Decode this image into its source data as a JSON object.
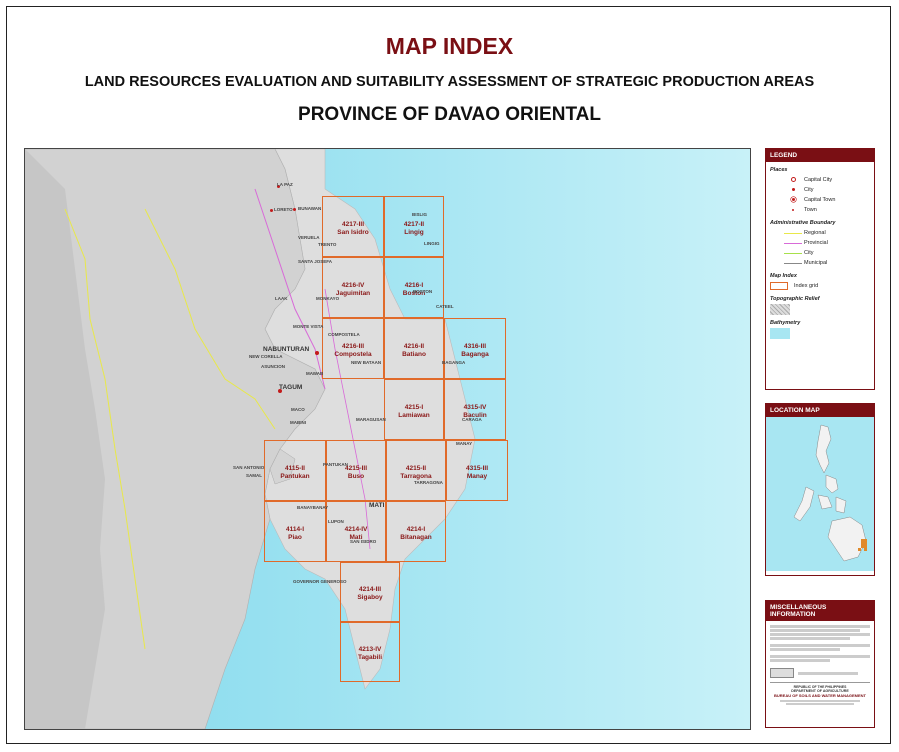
{
  "header": {
    "title": "MAP INDEX",
    "subtitle": "LAND RESOURCES EVALUATION AND SUITABILITY ASSESSMENT OF STRATEGIC PRODUCTION AREAS",
    "province": "PROVINCE OF DAVAO ORIENTAL"
  },
  "grid": [
    {
      "code": "4217-III",
      "name": "San Isidro"
    },
    {
      "code": "4217-II",
      "name": "Lingig"
    },
    {
      "code": "4216-IV",
      "name": "Jaguimitan"
    },
    {
      "code": "4216-I",
      "name": "Boston"
    },
    {
      "code": "4216-III",
      "name": "Compostela"
    },
    {
      "code": "4216-II",
      "name": "Batiano"
    },
    {
      "code": "4316-III",
      "name": "Baganga"
    },
    {
      "code": "4215-I",
      "name": "Lamiawan"
    },
    {
      "code": "4315-IV",
      "name": "Baculin"
    },
    {
      "code": "4115-II",
      "name": "Pantukan"
    },
    {
      "code": "4215-III",
      "name": "Buso"
    },
    {
      "code": "4215-II",
      "name": "Tarragona"
    },
    {
      "code": "4315-III",
      "name": "Manay"
    },
    {
      "code": "4114-I",
      "name": "Piao"
    },
    {
      "code": "4214-IV",
      "name": "Mati"
    },
    {
      "code": "4214-I",
      "name": "Bitanagan"
    },
    {
      "code": "4214-III",
      "name": "Sigaboy"
    },
    {
      "code": "4213-IV",
      "name": "Tagabili"
    }
  ],
  "places": {
    "la_paz": "LA PAZ",
    "bunawan": "BUNAWAN",
    "loreto": "LORETO",
    "bislig": "BISLIG",
    "veruela": "VERUELA",
    "trento": "TRENTO",
    "lingig": "LINGIG",
    "santa_josefa": "SANTA JOSEFA",
    "boston": "BOSTON",
    "laak": "LAAK",
    "monkayo": "MONKAYO",
    "cateel": "CATEEL",
    "monte_vista": "MONTE VISTA",
    "compostela": "COMPOSTELA",
    "nabunturan": "NABUNTURAN",
    "new_corella": "NEW CORELLA",
    "asuncion": "ASUNCION",
    "mawab": "MAWAB",
    "new_bataan": "NEW BATAAN",
    "baganga": "BAGANGA",
    "tagum": "TAGUM",
    "maco": "MACO",
    "mabini": "MABINI",
    "maragusan": "MARAGUSAN",
    "caraga": "CARAGA",
    "manay": "MANAY",
    "pantukan": "PANTUKAN",
    "san_antonio": "SAN ANTONIO",
    "samal": "SAMAL",
    "tarragona": "TARRAGONA",
    "banaybanay": "BANAYBANAY",
    "mati": "MATI",
    "lupon": "LUPON",
    "san_isidro": "SAN ISIDRO",
    "governor_generoso": "GOVERNOR GENEROSO"
  },
  "legend": {
    "title": "LEGEND",
    "places_heading": "Places",
    "places": [
      "Capital City",
      "City",
      "Capital Town",
      "Town"
    ],
    "admin_heading": "Administrative Boundary",
    "admin": [
      "Regional",
      "Provincial",
      "City",
      "Municipal"
    ],
    "admin_colors": [
      "#e8e84a",
      "#d86ad8",
      "#a8e04a",
      "#888888"
    ],
    "mapindex_heading": "Map Index",
    "index_grid": "Index grid",
    "relief_heading": "Topographic Relief",
    "bathy_heading": "Bathymetry"
  },
  "location_map": {
    "title": "LOCATION MAP"
  },
  "misc": {
    "title": "MISCELLANEOUS INFORMATION",
    "agency_line1": "REPUBLIC OF THE PHILIPPINES",
    "agency_line2": "DEPARTMENT OF AGRICULTURE",
    "agency_line3": "BUREAU OF SOILS AND WATER MANAGEMENT"
  },
  "colors": {
    "accent": "#7a0f14",
    "grid": "#e06a2a",
    "sea": "#a8e6f2",
    "land": "#dcdcdc"
  }
}
